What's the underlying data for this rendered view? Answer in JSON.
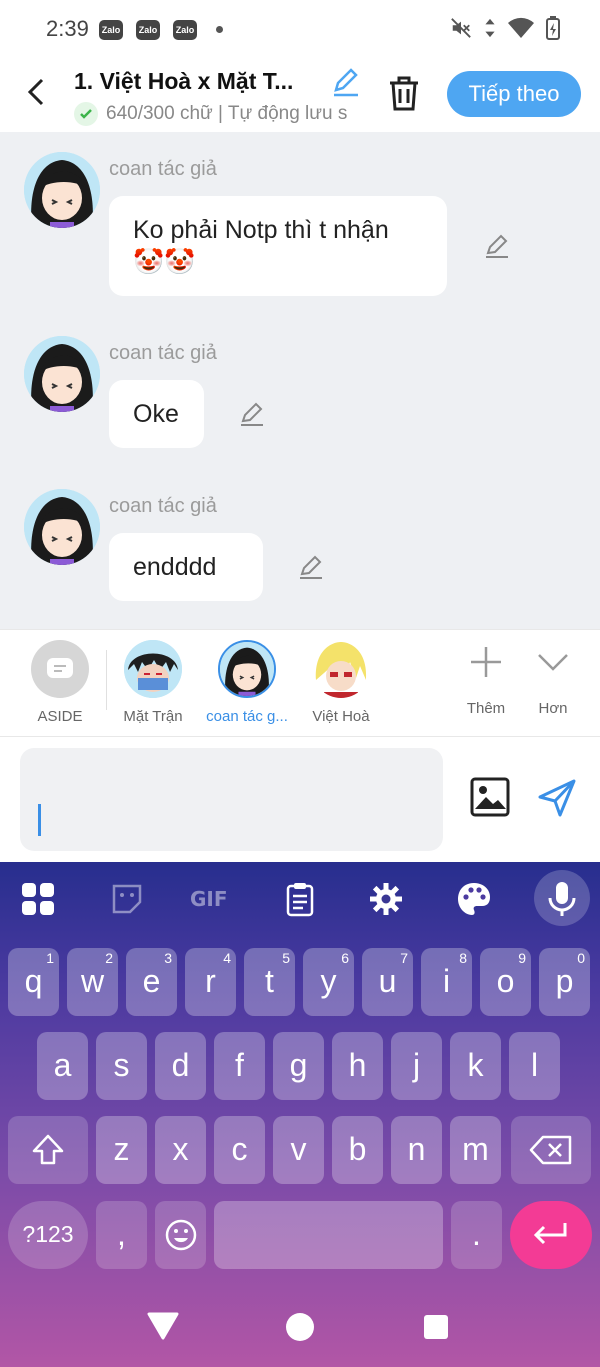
{
  "status_bar": {
    "time": "2:39",
    "notif_badges": [
      "Zalo",
      "Zalo",
      "Zalo"
    ]
  },
  "header": {
    "title": "1. Việt Hoà x Mặt T...",
    "meta": "640/300 chữ | Tự động lưu s",
    "next_label": "Tiếp theo"
  },
  "messages": [
    {
      "sender": "coan tác giả",
      "text": "Ko phải Notp thì t nhận 🤡🤡"
    },
    {
      "sender": "coan tác giả",
      "text": "Oke"
    },
    {
      "sender": "coan tác giả",
      "text": "endddd"
    }
  ],
  "characters": [
    {
      "label": "ASIDE"
    },
    {
      "label": "Mặt Trận"
    },
    {
      "label": "coan tác g..."
    },
    {
      "label": "Việt Hoà"
    },
    {
      "label": "Thêm"
    },
    {
      "label": "Hơn"
    }
  ],
  "keyboard": {
    "gif_label": "GIF",
    "row1": [
      "q",
      "w",
      "e",
      "r",
      "t",
      "y",
      "u",
      "i",
      "o",
      "p"
    ],
    "row1_hints": [
      "1",
      "2",
      "3",
      "4",
      "5",
      "6",
      "7",
      "8",
      "9",
      "0"
    ],
    "row2": [
      "a",
      "s",
      "d",
      "f",
      "g",
      "h",
      "j",
      "k",
      "l"
    ],
    "row3": [
      "z",
      "x",
      "c",
      "v",
      "b",
      "n",
      "m"
    ],
    "symbols_label": "?123",
    "comma": ",",
    "period": "."
  },
  "colors": {
    "accent": "#4ea6f2",
    "active_character": "#3a8fe6",
    "chat_bg": "#eef0f3",
    "enter_key": "#f33b95"
  }
}
